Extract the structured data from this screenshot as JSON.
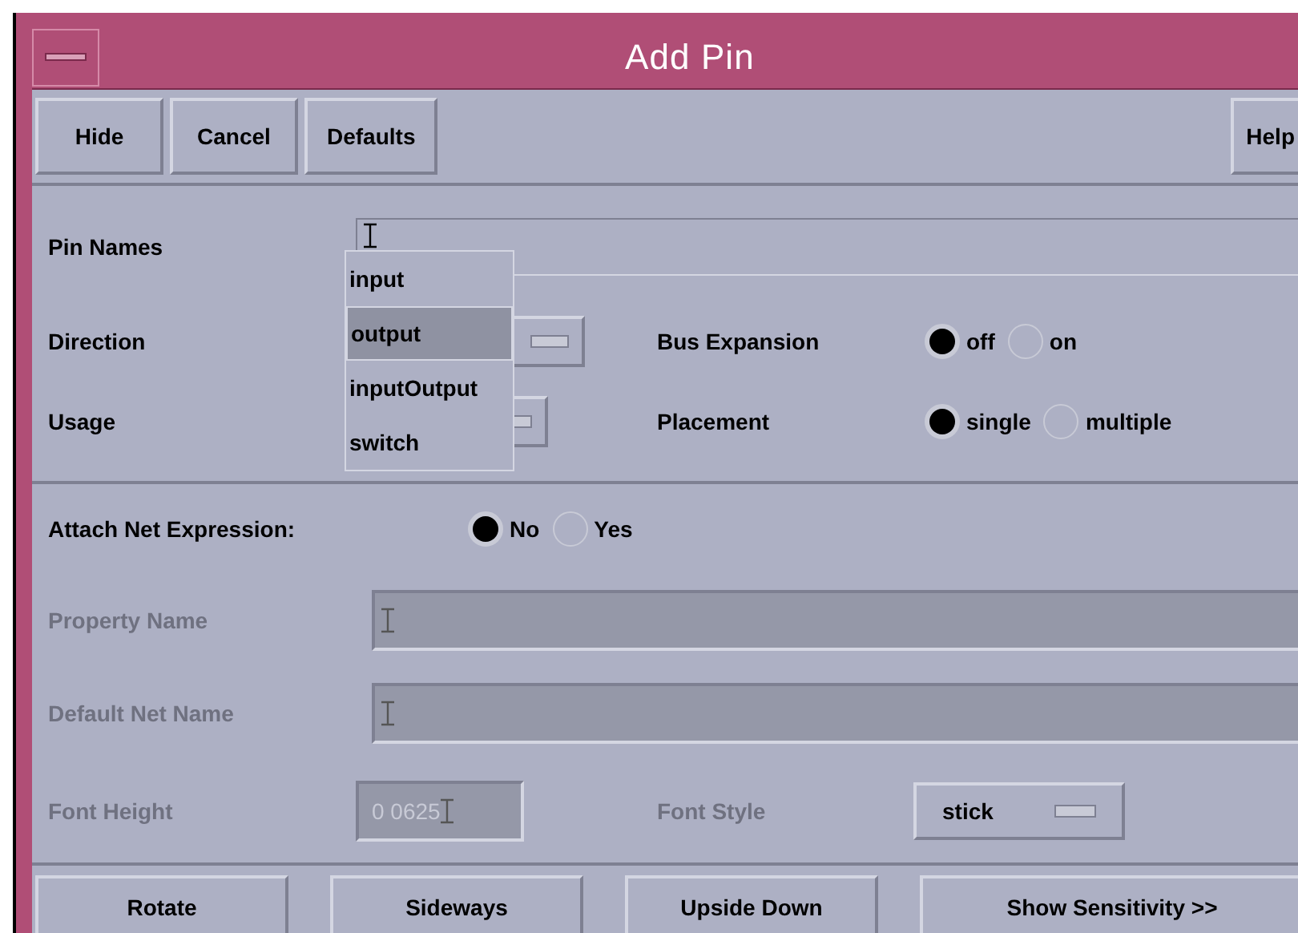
{
  "window": {
    "title": "Add Pin"
  },
  "toolbar": [
    {
      "label": "Hide"
    },
    {
      "label": "Cancel"
    },
    {
      "label": "Defaults"
    }
  ],
  "help_button": {
    "label": "Help"
  },
  "pin_names": {
    "label": "Pin Names"
  },
  "direction": {
    "label": "Direction"
  },
  "usage": {
    "label": "Usage"
  },
  "direction_menu": {
    "items": [
      {
        "label": "input",
        "selected": false
      },
      {
        "label": "output",
        "selected": true
      },
      {
        "label": "inputOutput",
        "selected": false
      },
      {
        "label": "switch",
        "selected": false
      }
    ]
  },
  "bus_expansion": {
    "label": "Bus Expansion",
    "options": [
      {
        "label": "off",
        "selected": true
      },
      {
        "label": "on",
        "selected": false
      }
    ]
  },
  "placement": {
    "label": "Placement",
    "options": [
      {
        "label": "single",
        "selected": true
      },
      {
        "label": "multiple",
        "selected": false
      }
    ]
  },
  "attach_net_expression": {
    "label": "Attach Net Expression:",
    "options": [
      {
        "label": "No",
        "selected": true
      },
      {
        "label": "Yes",
        "selected": false
      }
    ]
  },
  "property_name": {
    "label": "Property Name",
    "disabled": true
  },
  "default_net_name": {
    "label": "Default Net Name",
    "disabled": true
  },
  "font_height": {
    "label": "Font Height",
    "value": "0 0625",
    "disabled": true
  },
  "font_style": {
    "label": "Font Style",
    "value": "stick",
    "disabled": true
  },
  "bottom_buttons": [
    {
      "label": "Rotate"
    },
    {
      "label": "Sideways"
    },
    {
      "label": "Upside Down"
    },
    {
      "label": "Show Sensitivity >>"
    }
  ]
}
